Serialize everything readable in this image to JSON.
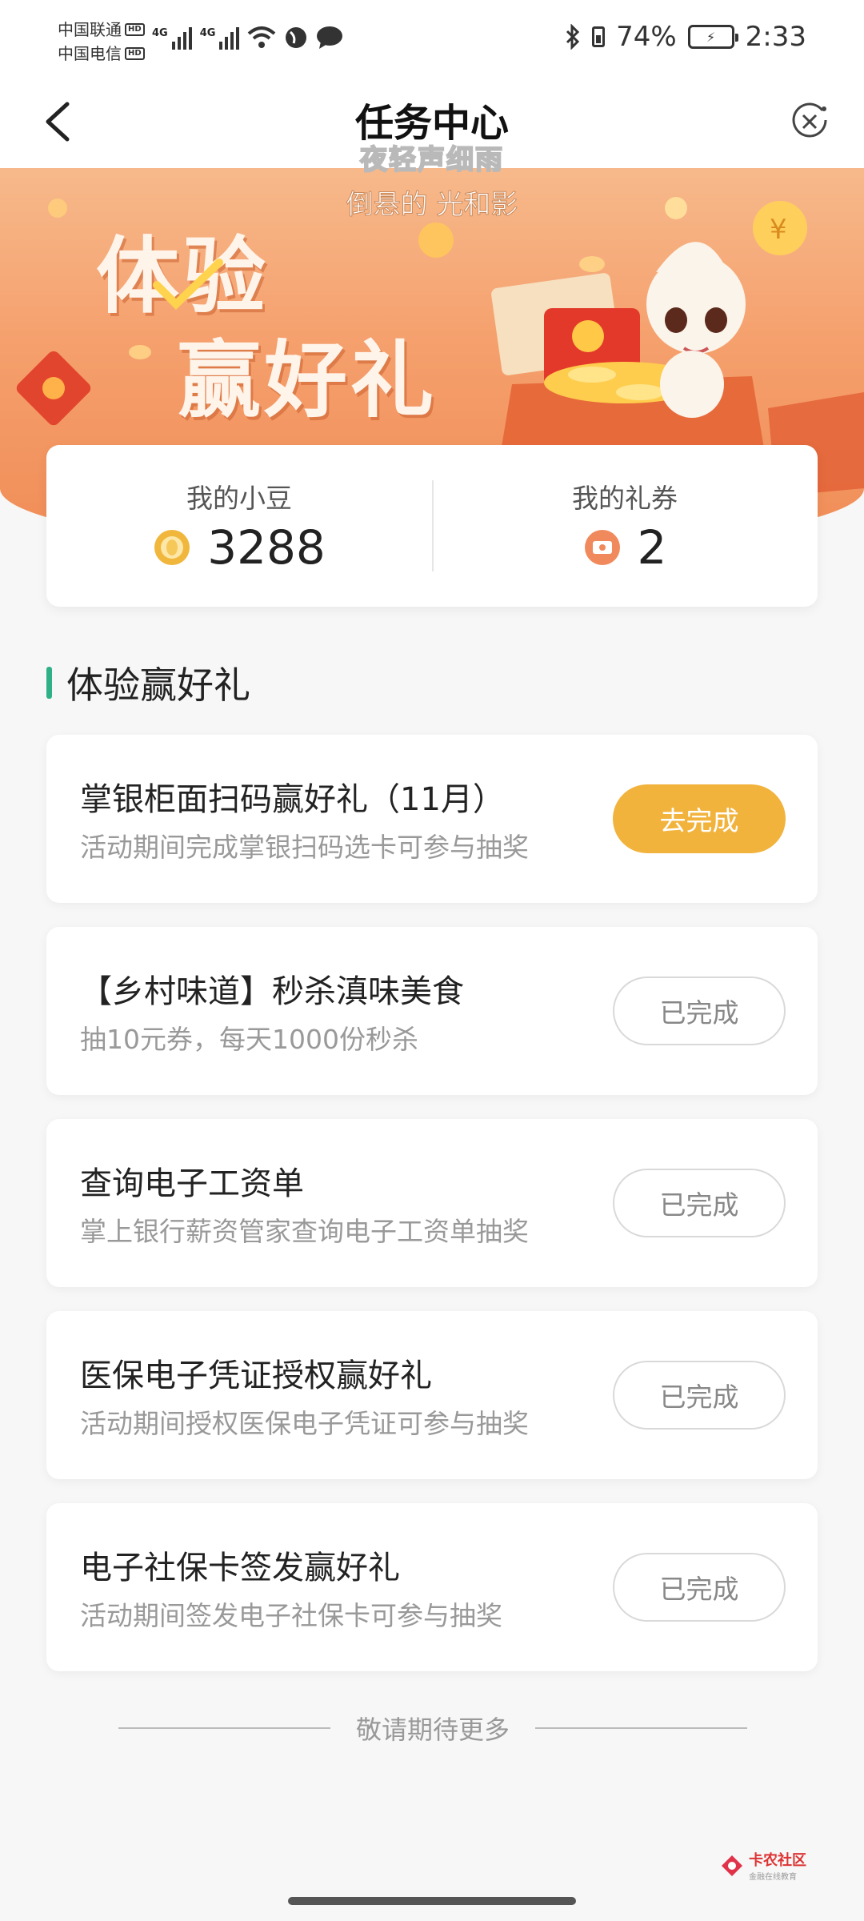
{
  "status_bar": {
    "carrier1": "中国联通",
    "carrier2": "中国电信",
    "hd": "HD",
    "net_tag": "4G",
    "battery": "74%",
    "time": "2:33"
  },
  "nav": {
    "title": "任务中心"
  },
  "watermark": {
    "line1": "夜轻声细雨",
    "line2": "倒悬的 光和影"
  },
  "banner": {
    "title_line1": "体验",
    "title_line2": "赢好礼"
  },
  "stats": {
    "beans_label": "我的小豆",
    "beans_value": "3288",
    "coupons_label": "我的礼券",
    "coupons_value": "2"
  },
  "section": {
    "title": "体验赢好礼"
  },
  "tasks": [
    {
      "name": "掌银柜面扫码赢好礼（11月）",
      "desc": "活动期间完成掌银扫码选卡可参与抽奖",
      "button": "去完成",
      "status": "todo"
    },
    {
      "name": "【乡村味道】秒杀滇味美食",
      "desc": "抽10元券，每天1000份秒杀",
      "button": "已完成",
      "status": "done"
    },
    {
      "name": "查询电子工资单",
      "desc": "掌上银行薪资管家查询电子工资单抽奖",
      "button": "已完成",
      "status": "done"
    },
    {
      "name": "医保电子凭证授权赢好礼",
      "desc": "活动期间授权医保电子凭证可参与抽奖",
      "button": "已完成",
      "status": "done"
    },
    {
      "name": "电子社保卡签发赢好礼",
      "desc": "活动期间签发电子社保卡可参与抽奖",
      "button": "已完成",
      "status": "done"
    }
  ],
  "footer": {
    "text": "敬请期待更多"
  },
  "logo": {
    "main": "卡农社区",
    "sub": "金融在线教育"
  },
  "colors": {
    "accent_green": "#2fb087",
    "todo_button": "#f2b33d",
    "banner_orange": "#f5a06d"
  }
}
